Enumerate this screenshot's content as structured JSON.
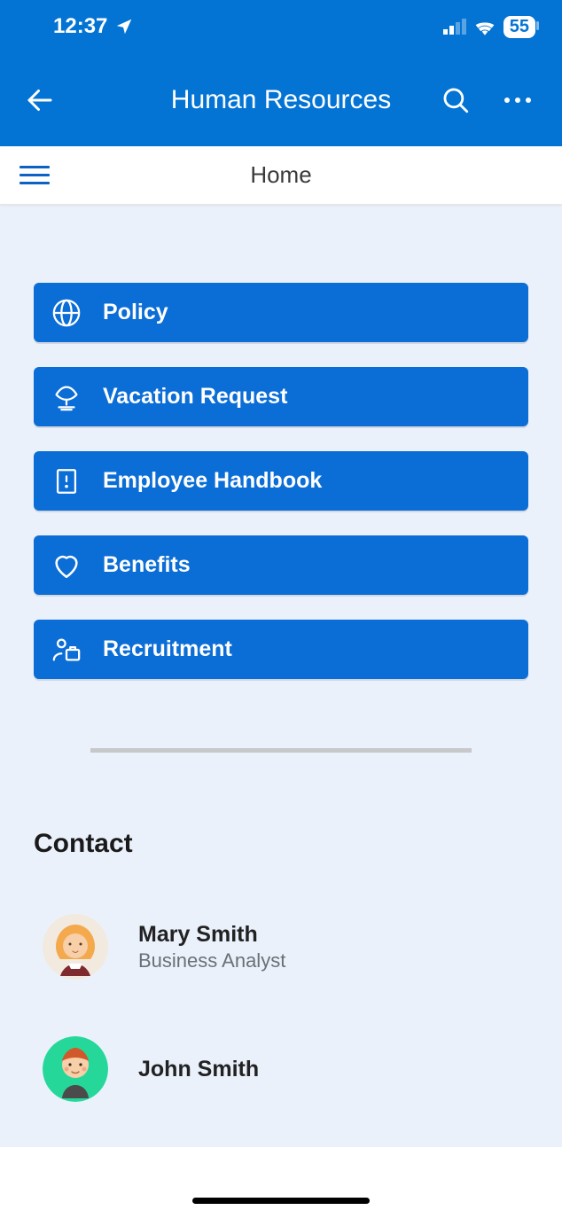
{
  "status": {
    "time": "12:37",
    "battery": "55"
  },
  "header": {
    "title": "Human Resources"
  },
  "subheader": {
    "title": "Home"
  },
  "tiles": [
    {
      "label": "Policy",
      "icon": "globe-icon"
    },
    {
      "label": "Vacation Request",
      "icon": "vacation-icon"
    },
    {
      "label": "Employee Handbook",
      "icon": "book-icon"
    },
    {
      "label": "Benefits",
      "icon": "heart-icon"
    },
    {
      "label": "Recruitment",
      "icon": "recruitment-icon"
    }
  ],
  "contact": {
    "heading": "Contact",
    "people": [
      {
        "name": "Mary Smith",
        "role": "Business Analyst"
      },
      {
        "name": "John Smith",
        "role": ""
      }
    ]
  }
}
